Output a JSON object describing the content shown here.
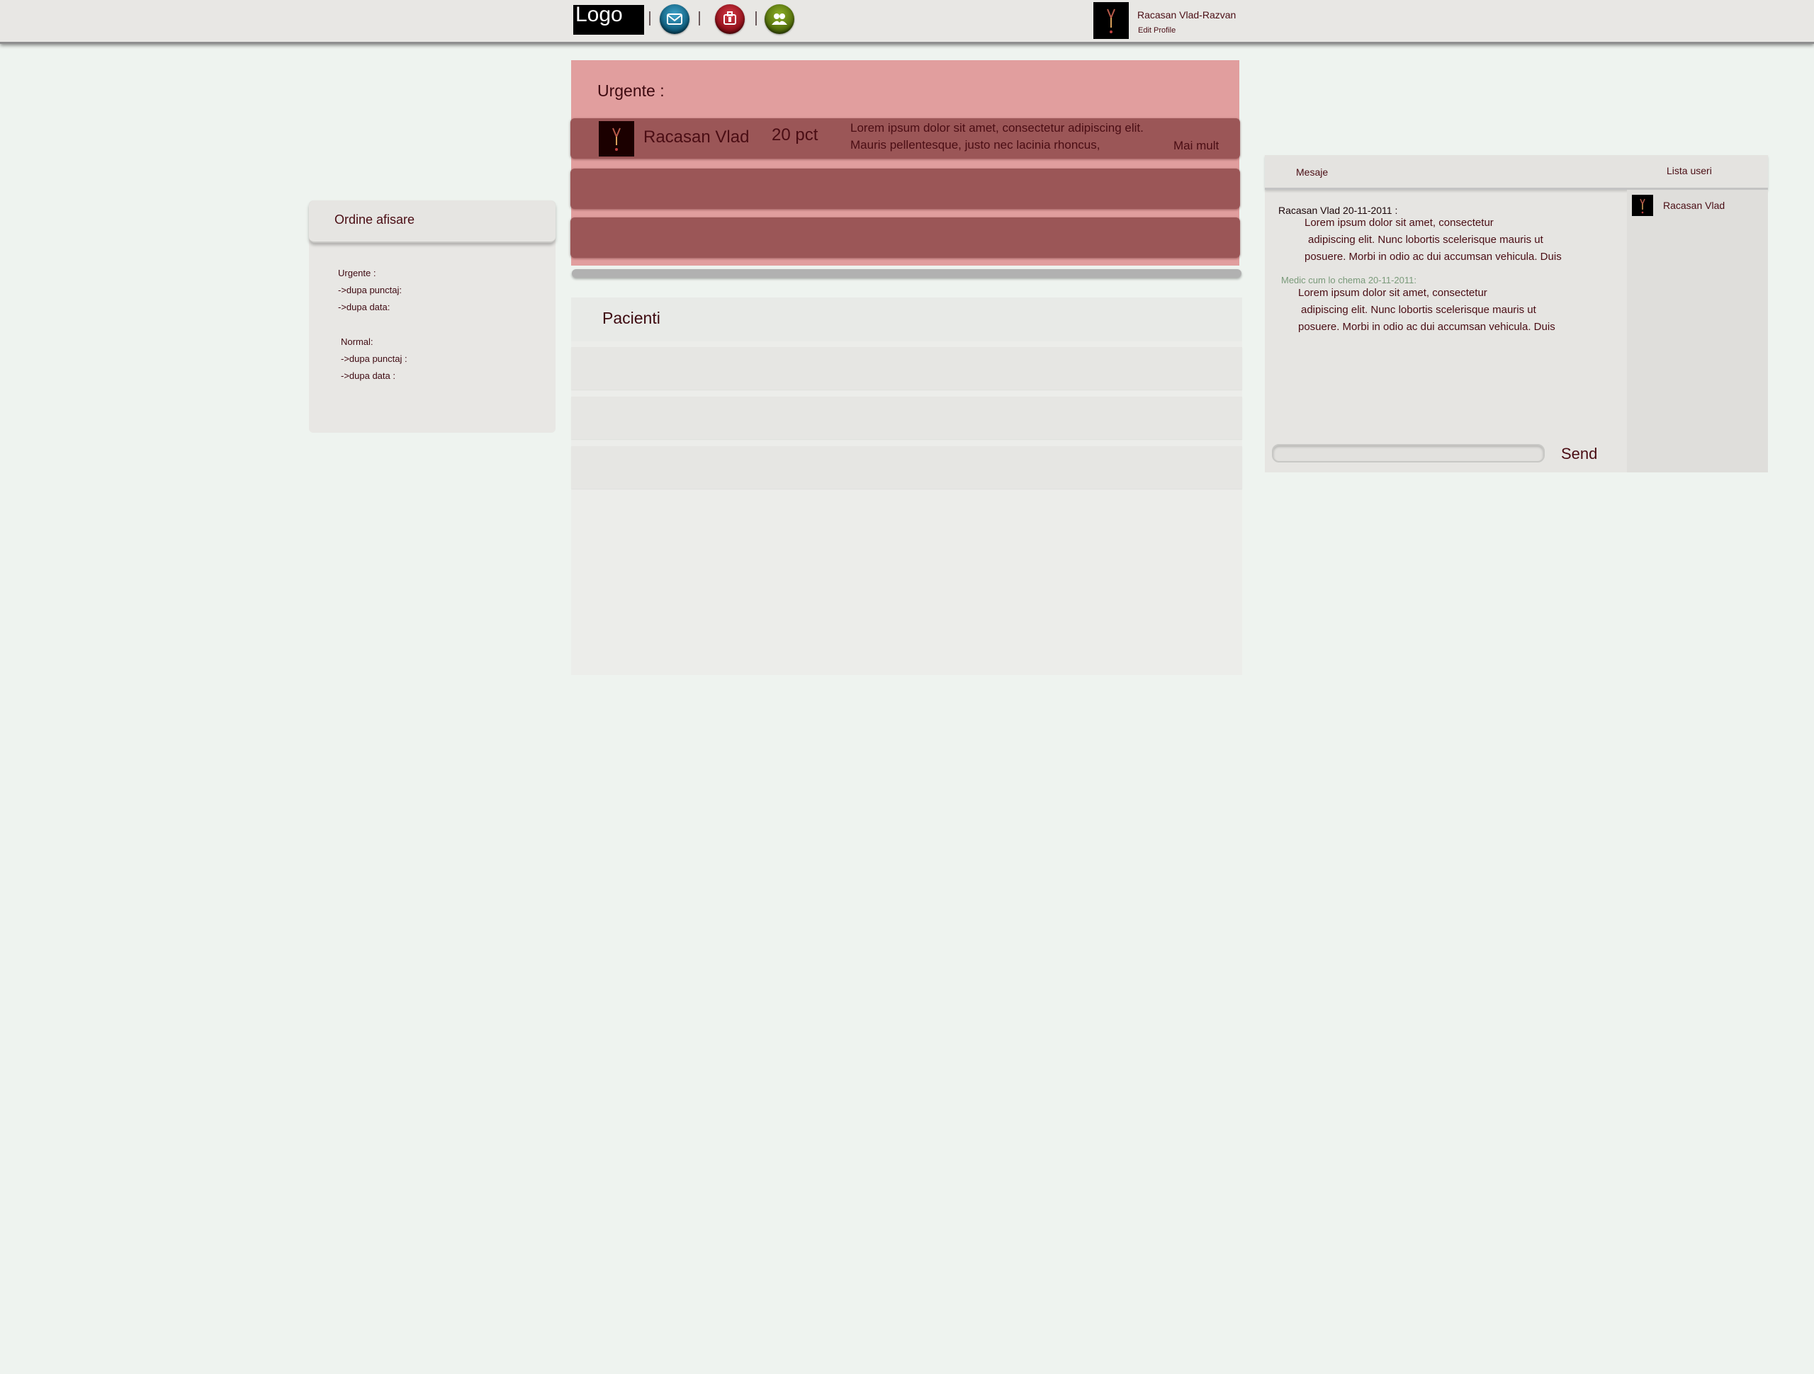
{
  "header": {
    "logo": "Logo",
    "nav_icons": [
      "mail-icon",
      "alert-icon",
      "users-icon"
    ],
    "separator": "|",
    "user_name": "Racasan Vlad-Razvan",
    "edit_profile": "Edit Profile"
  },
  "order_panel": {
    "title": "Ordine afisare",
    "urgent_label": "Urgente :",
    "urgent_by_score": "->dupa punctaj:",
    "urgent_by_date": "->dupa data:",
    "normal_label": "Normal:",
    "normal_by_score": "->dupa punctaj :",
    "normal_by_date": "->dupa data :"
  },
  "urgent": {
    "title": "Urgente :",
    "rows": [
      {
        "name": "Racasan Vlad",
        "score": "20 pct",
        "text": "Lorem ipsum dolor sit amet, consectetur adipiscing elit. Mauris pellentesque, justo nec lacinia rhoncus,",
        "more": "Mai mult"
      }
    ]
  },
  "patients": {
    "title": "Pacienti"
  },
  "messages": {
    "tab_messages": "Mesaje",
    "tab_users": "Lista useri",
    "thread": [
      {
        "author": "Racasan Vlad 20-11-2011 :",
        "lines": [
          "Lorem ipsum dolor sit amet, consectetur",
          "adipiscing elit. Nunc lobortis scelerisque mauris ut",
          "posuere. Morbi in odio ac dui accumsan vehicula. Duis"
        ]
      },
      {
        "author": "Medic cum lo chema 20-11-2011:",
        "lines": [
          "Lorem ipsum dolor sit amet, consectetur",
          "adipiscing elit. Nunc lobortis scelerisque mauris ut",
          "posuere. Morbi in odio ac dui accumsan vehicula. Duis"
        ]
      }
    ],
    "input_value": "",
    "send_label": "Send",
    "users": [
      {
        "name": "Racasan Vlad"
      }
    ]
  },
  "colors": {
    "page_bg": "#eef3ef",
    "accent_text": "#4a0d14",
    "urgent_panel": "#e19e9e",
    "urgent_row": "#9b5657",
    "second_author": "#7a9a7a"
  }
}
